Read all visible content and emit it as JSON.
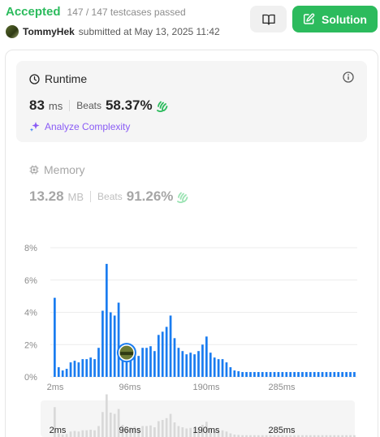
{
  "status": {
    "label": "Accepted",
    "testcases": "147 / 147 testcases passed"
  },
  "submitter": {
    "user": "TommyHek",
    "text": "submitted at May 13, 2025 11:42"
  },
  "toolbar": {
    "solution_label": "Solution",
    "book_icon": "book-open-icon",
    "solution_icon": "edit-icon"
  },
  "runtime": {
    "title": "Runtime",
    "value": "83",
    "unit": "ms",
    "beats_label": "Beats",
    "beats": "58.37%",
    "analyze_label": "Analyze Complexity",
    "icon": "clock-icon"
  },
  "memory": {
    "title": "Memory",
    "value": "13.28",
    "unit": "MB",
    "beats_label": "Beats",
    "beats": "91.26%",
    "icon": "chip-icon"
  },
  "colors": {
    "accent": "#2cbb5d",
    "bar": "#1a7cf0",
    "purple": "#8a5cf5",
    "muted_bar": "#d9d9d9"
  },
  "chart_data": {
    "type": "bar",
    "ylim": [
      0,
      8
    ],
    "yticks": [
      "0%",
      "2%",
      "4%",
      "6%",
      "8%"
    ],
    "xticks": [
      "2ms",
      "96ms",
      "190ms",
      "285ms"
    ],
    "values": [
      4.9,
      0.6,
      0.4,
      0.5,
      0.9,
      1.0,
      0.9,
      1.1,
      1.1,
      1.2,
      1.1,
      1.8,
      4.1,
      7.0,
      4.0,
      3.8,
      4.6,
      2.0,
      1.3,
      1.6,
      1.7,
      1.3,
      1.8,
      1.8,
      1.9,
      1.6,
      2.6,
      2.8,
      3.1,
      3.8,
      2.4,
      1.8,
      1.6,
      1.4,
      1.5,
      1.4,
      1.6,
      2.0,
      2.5,
      1.5,
      1.2,
      1.1,
      1.1,
      0.9,
      0.6,
      0.4,
      0.35,
      0.3,
      0.3,
      0.3,
      0.3,
      0.3,
      0.3,
      0.3,
      0.3,
      0.3,
      0.3,
      0.3,
      0.3,
      0.3,
      0.3,
      0.3,
      0.3,
      0.3,
      0.3,
      0.3,
      0.3,
      0.3,
      0.3,
      0.3,
      0.3,
      0.3,
      0.3,
      0.3,
      0.3,
      0.3
    ],
    "highlight_index": 18,
    "grid": true
  }
}
